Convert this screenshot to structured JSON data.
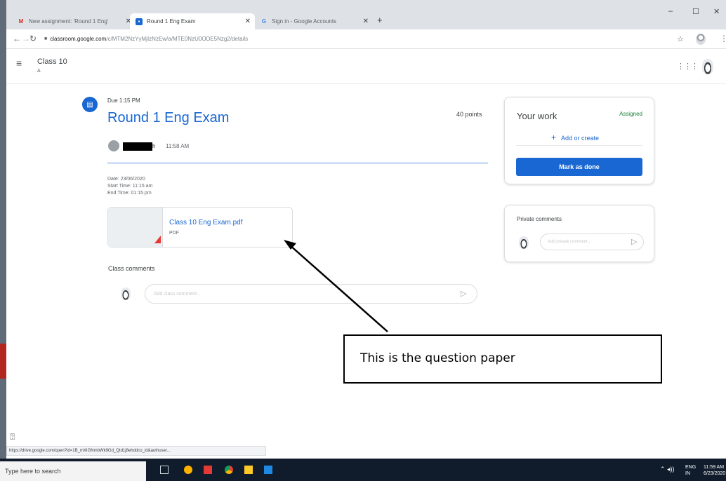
{
  "browser": {
    "tabs": [
      {
        "label": "New assignment: 'Round 1 Eng'",
        "favicon": "gmail-icon",
        "active": false
      },
      {
        "label": "Round 1 Eng Exam",
        "favicon": "classroom-icon",
        "active": true
      },
      {
        "label": "Sign in - Google Accounts",
        "favicon": "google-icon",
        "active": false
      }
    ],
    "url_host": "classroom.google.com",
    "url_path": "/c/MTM2NzYyMjIzNzEw/a/MTE0NzU0ODE5Nzg2/details",
    "status_url": "https://drive.google.com/open?id=1B_mXIGNmbWk9Gd_Qtd1j8ehddco_id&authuser..."
  },
  "classroom": {
    "class_name": "Class 10",
    "section": "A"
  },
  "assignment": {
    "due": "Due 1:15 PM",
    "title": "Round 1 Eng Exam",
    "points": "40 points",
    "author_suffix": "h",
    "posted_time": "11:58 AM",
    "description": [
      "Date: 23/06/2020",
      "Start Time: 11:15 am",
      "End Time: 01:15 pm"
    ],
    "attachment": {
      "title": "Class 10 Eng Exam.pdf",
      "type": "PDF"
    },
    "class_comments_label": "Class comments",
    "class_comment_placeholder": "Add class comment..."
  },
  "your_work": {
    "title": "Your work",
    "status": "Assigned",
    "add_label": "Add or create",
    "mark_done_label": "Mark as done"
  },
  "private_comments": {
    "title": "Private comments",
    "placeholder": "Add private comment..."
  },
  "annotation": {
    "text": "This is the question paper"
  },
  "taskbar": {
    "search_placeholder": "Type here to search",
    "lang_top": "ENG",
    "lang_bottom": "IN",
    "time": "11:59 AM",
    "date": "6/23/2020"
  },
  "colors": {
    "primary": "#1967d2",
    "assigned_green": "#188038",
    "taskbar": "#101c2c"
  }
}
